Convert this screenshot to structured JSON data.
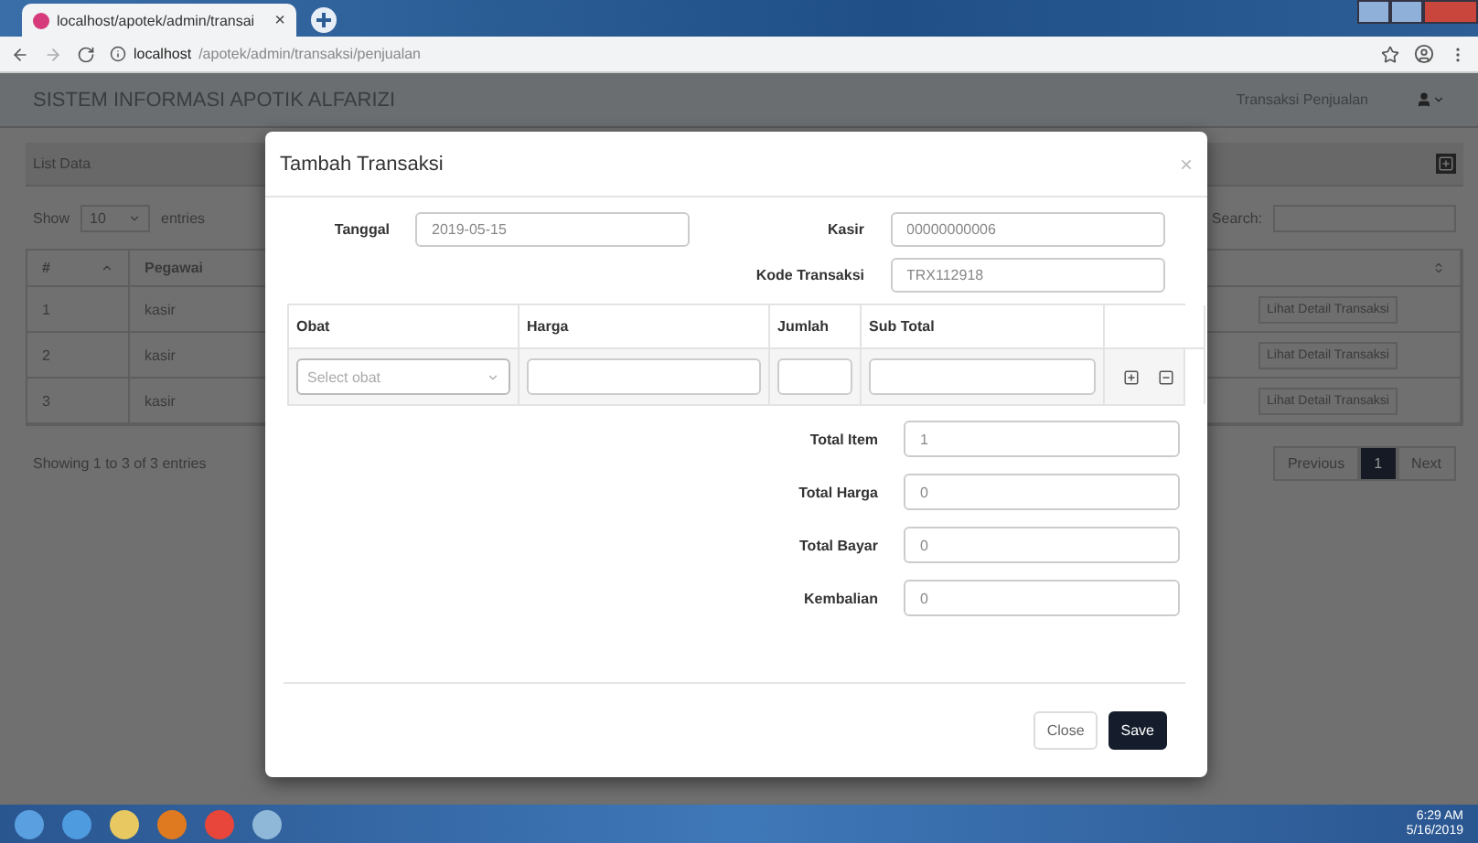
{
  "browser": {
    "tab_title": "localhost/apotek/admin/transai",
    "tab_close": "×",
    "url_host": "localhost",
    "url_path": "/apotek/admin/transaksi/penjualan"
  },
  "page": {
    "brand": "SISTEM INFORMASI APOTIK ALFARIZI",
    "nav_link": "Transaksi Penjualan",
    "panel_title": "List Data",
    "show_label": "Show",
    "entries_value": "10",
    "entries_label": "entries",
    "search_label": "Search:",
    "columns": [
      "#",
      "Pegawai"
    ],
    "rows": [
      {
        "number": "1",
        "pegawai": "kasir",
        "action": "Lihat Detail Transaksi"
      },
      {
        "number": "2",
        "pegawai": "kasir",
        "action": "Lihat Detail Transaksi"
      },
      {
        "number": "3",
        "pegawai": "kasir",
        "action": "Lihat Detail Transaksi"
      }
    ],
    "info": "Showing 1 to 3 of 3 entries",
    "pagination": [
      {
        "label": "Previous",
        "selected": false
      },
      {
        "label": "1",
        "selected": true
      },
      {
        "label": "Next",
        "selected": false
      }
    ]
  },
  "modal": {
    "title": "Tambah Transaksi",
    "close": "×",
    "left_fields": [
      {
        "label": "Tanggal",
        "value": "2019-05-15"
      }
    ],
    "right_fields": [
      {
        "label": "Kasir",
        "value": "00000000006"
      },
      {
        "label": "Kode Transaksi",
        "value": "TRX112918"
      }
    ],
    "columns": [
      "Obat",
      "Harga",
      "Jumlah",
      "Sub Total"
    ],
    "select_placeholder": "Select obat",
    "totals": [
      {
        "label": "Total Item",
        "value": "1"
      },
      {
        "label": "Total Harga",
        "value": "0"
      },
      {
        "label": "Total Bayar",
        "value": "0"
      },
      {
        "label": "Kembalian",
        "value": "0"
      }
    ],
    "buttons": [
      {
        "label": "Close",
        "kind": "secondary"
      },
      {
        "label": "Save",
        "kind": "primary"
      }
    ]
  },
  "taskbar": {
    "time": "6:29 AM",
    "date": "5/16/2019"
  }
}
